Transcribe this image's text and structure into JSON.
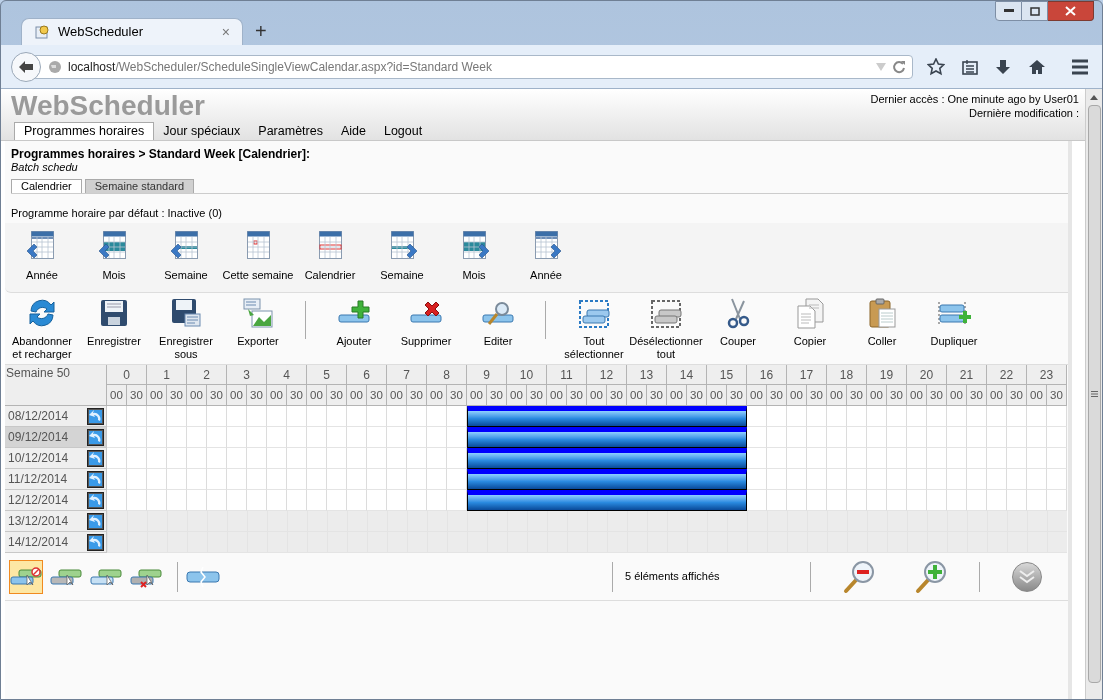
{
  "browser": {
    "tab_title": "WebScheduler",
    "tab_close": "×",
    "new_tab": "+",
    "url_host": "localhost",
    "url_path": "/WebScheduler/ScheduleSingleViewCalendar.aspx?id=Standard Week"
  },
  "header": {
    "logo": "WebScheduler",
    "last_access": "Dernier accès : One minute ago by User01",
    "last_modified": "Dernière modification :"
  },
  "nav": [
    {
      "label": "Programmes horaires",
      "selected": true
    },
    {
      "label": "Jour spéciaux",
      "selected": false
    },
    {
      "label": "Paramètres",
      "selected": false
    },
    {
      "label": "Aide",
      "selected": false
    },
    {
      "label": "Logout",
      "selected": false
    }
  ],
  "breadcrumb": "Programmes horaires > Standard Week [Calendrier]:",
  "description": "Batch schedu",
  "view_tabs": [
    {
      "label": "Calendrier",
      "selected": true
    },
    {
      "label": "Semaine standard",
      "selected": false
    }
  ],
  "default_schedule": "Programme horaire par défaut : Inactive (0)",
  "nav_toolbar": [
    {
      "label": "Année",
      "kind": "prev-year"
    },
    {
      "label": "Mois",
      "kind": "prev-month"
    },
    {
      "label": "Semaine",
      "kind": "prev-week"
    },
    {
      "label": "Cette semaine",
      "kind": "this-week"
    },
    {
      "label": "Calendrier",
      "kind": "calendar"
    },
    {
      "label": "Semaine",
      "kind": "next-week"
    },
    {
      "label": "Mois",
      "kind": "next-month"
    },
    {
      "label": "Année",
      "kind": "next-year"
    }
  ],
  "action_toolbar": [
    {
      "label": "Abandonner et recharger",
      "kind": "reload"
    },
    {
      "label": "Enregistrer",
      "kind": "save"
    },
    {
      "label": "Enregistrer sous",
      "kind": "save-as"
    },
    {
      "label": "Exporter",
      "kind": "export"
    },
    {
      "label": "Ajouter",
      "kind": "add",
      "separator_before": true
    },
    {
      "label": "Supprimer",
      "kind": "delete"
    },
    {
      "label": "Editer",
      "kind": "edit"
    },
    {
      "label": "Tout sélectionner",
      "kind": "select-all",
      "separator_before": true
    },
    {
      "label": "Désélectionner tout",
      "kind": "deselect-all"
    },
    {
      "label": "Couper",
      "kind": "cut"
    },
    {
      "label": "Copier",
      "kind": "copy"
    },
    {
      "label": "Coller",
      "kind": "paste"
    },
    {
      "label": "Dupliquer",
      "kind": "duplicate"
    }
  ],
  "grid": {
    "week": "Semaine 50",
    "hours": [
      {
        "label": "0",
        "minutes": [
          "00",
          "30"
        ]
      },
      {
        "label": "1",
        "minutes": [
          "00",
          "30"
        ]
      },
      {
        "label": "2",
        "minutes": [
          "00",
          "30"
        ]
      },
      {
        "label": "3",
        "minutes": [
          "00",
          "30"
        ]
      },
      {
        "label": "4",
        "minutes": [
          "00",
          "30"
        ]
      },
      {
        "label": "5",
        "minutes": [
          "00",
          "30"
        ]
      },
      {
        "label": "6",
        "minutes": [
          "00",
          "30"
        ]
      },
      {
        "label": "7",
        "minutes": [
          "00",
          "30"
        ]
      },
      {
        "label": "8",
        "minutes": [
          "00",
          "30"
        ]
      },
      {
        "label": "9",
        "minutes": [
          "00",
          "30"
        ]
      },
      {
        "label": "10",
        "minutes": [
          "00",
          "30"
        ]
      },
      {
        "label": "11",
        "minutes": [
          "00",
          "30"
        ]
      },
      {
        "label": "12",
        "minutes": [
          "00",
          "30"
        ]
      },
      {
        "label": "13",
        "minutes": [
          "00",
          "30"
        ]
      },
      {
        "label": "14",
        "minutes": [
          "00",
          "30"
        ]
      },
      {
        "label": "15",
        "minutes": [
          "00",
          "30"
        ]
      },
      {
        "label": "16",
        "minutes": [
          "00",
          "30"
        ]
      },
      {
        "label": "17",
        "minutes": [
          "00",
          "30"
        ]
      },
      {
        "label": "18",
        "minutes": [
          "00",
          "30"
        ]
      },
      {
        "label": "19",
        "minutes": [
          "00",
          "30"
        ]
      },
      {
        "label": "20",
        "minutes": [
          "00",
          "30"
        ]
      },
      {
        "label": "21",
        "minutes": [
          "00",
          "30"
        ]
      },
      {
        "label": "22",
        "minutes": [
          "00",
          "30"
        ]
      },
      {
        "label": "23",
        "minutes": [
          "00",
          "30"
        ]
      }
    ],
    "days": [
      {
        "date": "08/12/2014",
        "selected": false,
        "weekend": false,
        "slots": [
          false,
          false,
          false,
          false,
          false,
          false,
          false,
          false,
          false,
          false,
          false,
          false,
          false,
          false,
          false,
          false,
          false,
          false,
          true,
          true,
          true,
          true,
          true,
          true,
          true,
          true,
          true,
          true,
          true,
          true,
          true,
          true,
          false,
          false,
          false,
          false,
          false,
          false,
          false,
          false,
          false,
          false,
          false,
          false,
          false,
          false,
          false,
          false
        ]
      },
      {
        "date": "09/12/2014",
        "selected": true,
        "weekend": false,
        "slots": [
          false,
          false,
          false,
          false,
          false,
          false,
          false,
          false,
          false,
          false,
          false,
          false,
          false,
          false,
          false,
          false,
          false,
          false,
          true,
          true,
          true,
          true,
          true,
          true,
          true,
          true,
          true,
          true,
          true,
          true,
          true,
          true,
          false,
          false,
          false,
          false,
          false,
          false,
          false,
          false,
          false,
          false,
          false,
          false,
          false,
          false,
          false,
          false
        ]
      },
      {
        "date": "10/12/2014",
        "selected": false,
        "weekend": false,
        "slots": [
          false,
          false,
          false,
          false,
          false,
          false,
          false,
          false,
          false,
          false,
          false,
          false,
          false,
          false,
          false,
          false,
          false,
          false,
          true,
          true,
          true,
          true,
          true,
          true,
          true,
          true,
          true,
          true,
          true,
          true,
          true,
          true,
          false,
          false,
          false,
          false,
          false,
          false,
          false,
          false,
          false,
          false,
          false,
          false,
          false,
          false,
          false,
          false
        ]
      },
      {
        "date": "11/12/2014",
        "selected": false,
        "weekend": false,
        "slots": [
          false,
          false,
          false,
          false,
          false,
          false,
          false,
          false,
          false,
          false,
          false,
          false,
          false,
          false,
          false,
          false,
          false,
          false,
          true,
          true,
          true,
          true,
          true,
          true,
          true,
          true,
          true,
          true,
          true,
          true,
          true,
          true,
          false,
          false,
          false,
          false,
          false,
          false,
          false,
          false,
          false,
          false,
          false,
          false,
          false,
          false,
          false,
          false
        ]
      },
      {
        "date": "12/12/2014",
        "selected": false,
        "weekend": false,
        "slots": [
          false,
          false,
          false,
          false,
          false,
          false,
          false,
          false,
          false,
          false,
          false,
          false,
          false,
          false,
          false,
          false,
          false,
          false,
          true,
          true,
          true,
          true,
          true,
          true,
          true,
          true,
          true,
          true,
          true,
          true,
          true,
          true,
          false,
          false,
          false,
          false,
          false,
          false,
          false,
          false,
          false,
          false,
          false,
          false,
          false,
          false,
          false,
          false
        ]
      },
      {
        "date": "13/12/2014",
        "selected": false,
        "weekend": true
      },
      {
        "date": "14/12/2014",
        "selected": false,
        "weekend": true
      }
    ]
  },
  "bottom_toolbar": {
    "modes": [
      {
        "kind": "forbid",
        "selected": true
      },
      {
        "kind": "move",
        "selected": false
      },
      {
        "kind": "copy",
        "selected": false
      },
      {
        "kind": "delete",
        "selected": false
      }
    ],
    "status": "5 éléments affichés"
  }
}
